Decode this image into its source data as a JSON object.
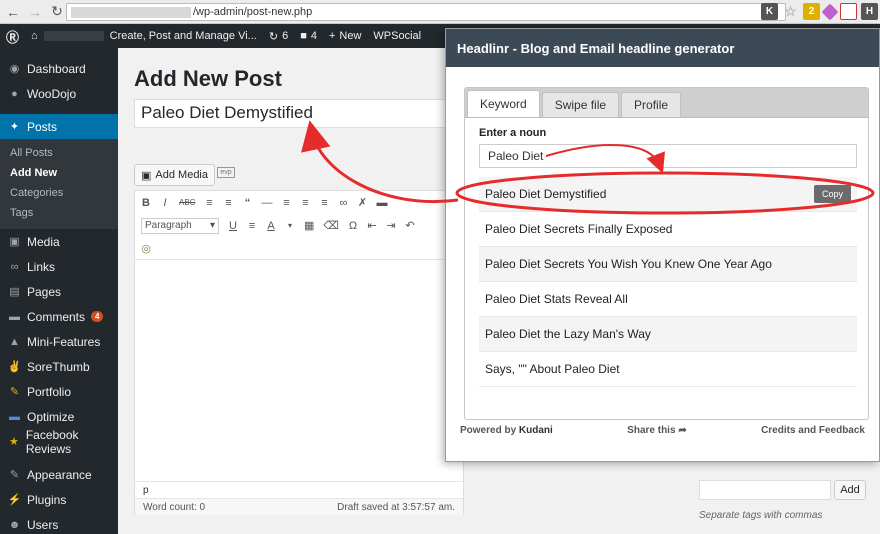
{
  "browser": {
    "url": "/wp-admin/post-new.php",
    "extensions": [
      {
        "icon": "k-extension-icon",
        "label": "K",
        "color": "#555555"
      },
      {
        "icon": "star-icon",
        "label": "☆",
        "color": "#bbbbbb"
      },
      {
        "icon": "bolt-extension-icon",
        "label": "2",
        "color": "#e0b000"
      },
      {
        "icon": "tag-extension-icon",
        "label": "",
        "color": "#c061cb"
      },
      {
        "icon": "grid-extension-icon",
        "label": "",
        "color": "#cc3333"
      },
      {
        "icon": "headlinr-extension-icon",
        "label": "H",
        "color": "#555555"
      }
    ]
  },
  "admin_bar": {
    "site_title": "Create, Post and Manage Vi...",
    "updates_count": "6",
    "comments_count": "4",
    "new_label": "New",
    "wpsocial_label": "WPSocial"
  },
  "sidebar": {
    "items": [
      {
        "label": "Dashboard",
        "icon": "dashboard-icon"
      },
      {
        "label": "WooDojo",
        "icon": "woodojo-icon"
      },
      {
        "label": "Posts",
        "icon": "pin-icon"
      },
      {
        "label": "Media",
        "icon": "media-icon"
      },
      {
        "label": "Links",
        "icon": "link-icon"
      },
      {
        "label": "Pages",
        "icon": "pages-icon"
      },
      {
        "label": "Comments",
        "icon": "comments-icon",
        "badge": "4"
      },
      {
        "label": "Mini-Features",
        "icon": "mini-features-icon"
      },
      {
        "label": "SoreThumb",
        "icon": "thumb-icon"
      },
      {
        "label": "Portfolio",
        "icon": "portfolio-icon"
      },
      {
        "label": "Optimize",
        "icon": "optimize-icon"
      },
      {
        "label": "Facebook Reviews",
        "icon": "facebook-reviews-icon"
      },
      {
        "label": "Appearance",
        "icon": "appearance-icon"
      },
      {
        "label": "Plugins",
        "icon": "plugins-icon"
      },
      {
        "label": "Users",
        "icon": "users-icon"
      }
    ],
    "posts_submenu": [
      "All Posts",
      "Add New",
      "Categories",
      "Tags"
    ]
  },
  "editor": {
    "page_title": "Add New Post",
    "post_title": "Paleo Diet Demystified",
    "add_media_label": "Add Media",
    "evp_label": "evp",
    "format_value": "Paragraph",
    "path": "p",
    "word_count": "Word count: 0",
    "draft_status": "Draft saved at 3:57:57 am."
  },
  "tags_box": {
    "add_label": "Add",
    "hint": "Separate tags with commas"
  },
  "headlinr": {
    "title": "Headlinr - Blog and Email headline generator",
    "tabs": [
      "Keyword",
      "Swipe file",
      "Profile"
    ],
    "noun_label": "Enter a noun",
    "noun_value": "Paleo Diet",
    "results": [
      "Paleo Diet Demystified",
      "Paleo Diet Secrets Finally Exposed",
      "Paleo Diet Secrets You Wish You Knew One Year Ago",
      "Paleo Diet Stats Reveal All",
      "Paleo Diet the Lazy Man's Way",
      "Says, \"\" About Paleo Diet"
    ],
    "copy_label": "Copy",
    "footer": {
      "powered_prefix": "Powered by",
      "powered_brand": "Kudani",
      "share_label": "Share this",
      "credits_label": "Credits and Feedback"
    }
  },
  "colors": {
    "wp_dark": "#23282d",
    "wp_active": "#0073aa",
    "annotation_red": "#e52b2b",
    "popup_header": "#3c4a57"
  }
}
